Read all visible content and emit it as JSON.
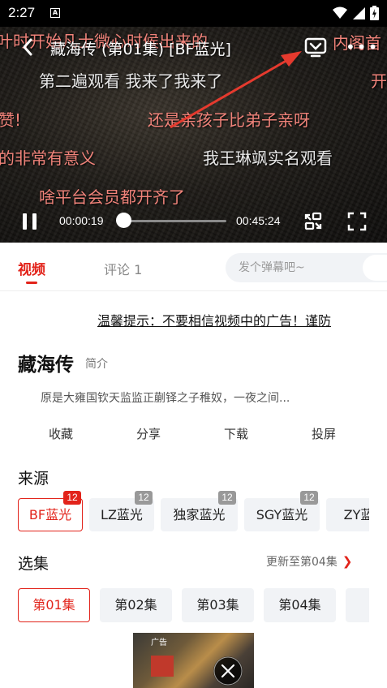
{
  "status_bar": {
    "time": "2:27",
    "notification_letter": "A"
  },
  "player": {
    "title": "藏海传 (第01集) [BF蓝光]",
    "current_time": "00:00:19",
    "total_time": "00:45:24",
    "progress": 0.007,
    "danmaku": [
      {
        "text": "叶时开始凡士微心时候出来的",
        "color": "r"
      },
      {
        "text": "内阁首",
        "color": "r"
      },
      {
        "text": "第二遍观看 我来了我来了",
        "color": "w"
      },
      {
        "text": "开",
        "color": "r"
      },
      {
        "text": "赞!",
        "color": "r"
      },
      {
        "text": "还是亲孩子比弟子亲呀",
        "color": "r"
      },
      {
        "text": "的非常有意义",
        "color": "r"
      },
      {
        "text": "我王琳飒实名观看",
        "color": "w"
      },
      {
        "text": "啥平台会员都开齐了",
        "color": "r"
      }
    ]
  },
  "tabs": {
    "video": "视频",
    "comments": "评论 1"
  },
  "danmu_input": {
    "placeholder": "发个弹幕吧~"
  },
  "notice": "温馨提示：不要相信视频中的广告！谨防",
  "drama": {
    "title": "藏海传",
    "intro_link": "简介",
    "synopsis": "原是大雍国钦天监监正蒯铎之子稚奴，一夜之间..."
  },
  "actions": [
    "收藏",
    "分享",
    "下载",
    "投屏"
  ],
  "sources": {
    "title": "来源",
    "items": [
      {
        "label": "BF蓝光",
        "count": "12",
        "active": true
      },
      {
        "label": "LZ蓝光",
        "count": "12",
        "active": false
      },
      {
        "label": "独家蓝光",
        "count": "12",
        "active": false
      },
      {
        "label": "SGY蓝光",
        "count": "12",
        "active": false
      },
      {
        "label": "ZY蓝",
        "count": "",
        "active": false
      }
    ]
  },
  "episodes": {
    "title": "选集",
    "update_text": "更新至第04集",
    "items": [
      {
        "label": "第01集",
        "active": true
      },
      {
        "label": "第02集",
        "active": false
      },
      {
        "label": "第03集",
        "active": false
      },
      {
        "label": "第04集",
        "active": false
      },
      {
        "label": "第",
        "active": false
      }
    ]
  },
  "ad": {
    "label": "广告"
  },
  "colors": {
    "accent": "#e2231a",
    "chip_bg": "#f1f3f6",
    "badge_gray": "#999999"
  },
  "icons": [
    "back-arrow-icon",
    "cast-icon",
    "more-dots-icon",
    "pause-icon",
    "swap-icon",
    "fullscreen-icon",
    "chevron-right-icon",
    "close-icon",
    "wifi-icon",
    "signal-icon",
    "battery-icon"
  ]
}
